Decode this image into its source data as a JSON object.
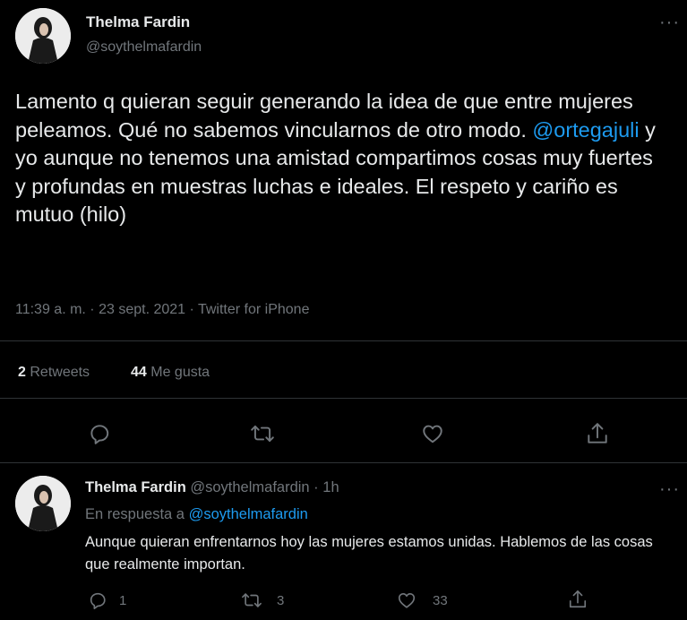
{
  "main_tweet": {
    "display_name": "Thelma Fardin",
    "handle": "@soythelmafardin",
    "text_before": "Lamento q quieran seguir generando la idea de que entre mujeres peleamos. Qué no sabemos vincularnos de otro modo. ",
    "mention": "@ortegajuli",
    "text_after": " y yo aunque no tenemos una amistad compartimos cosas muy fuertes y profundas en muestras luchas e ideales. El respeto y cariño es mutuo (hilo)",
    "timestamp": "11:39 a. m. · 23 sept. 2021 · Twitter for iPhone",
    "retweets_count": "2",
    "retweets_label": "Retweets",
    "likes_count": "44",
    "likes_label": "Me gusta"
  },
  "reply_tweet": {
    "display_name": "Thelma Fardin",
    "handle_time": "@soythelmafardin · 1h",
    "reply_to_prefix": "En respuesta a ",
    "reply_to_handle": "@soythelmafardin",
    "text": "Aunque quieran enfrentarnos hoy las mujeres estamos unidas. Hablemos de las cosas que realmente importan.",
    "reply_count": "1",
    "retweet_count": "3",
    "like_count": "33"
  },
  "icons": [
    "more-icon",
    "reply-icon",
    "retweet-icon",
    "like-icon",
    "share-icon"
  ],
  "colors": {
    "background": "#000000",
    "text": "#e7e9ea",
    "muted": "#71767b",
    "link": "#1d9bf0",
    "divider": "#2f3336"
  }
}
